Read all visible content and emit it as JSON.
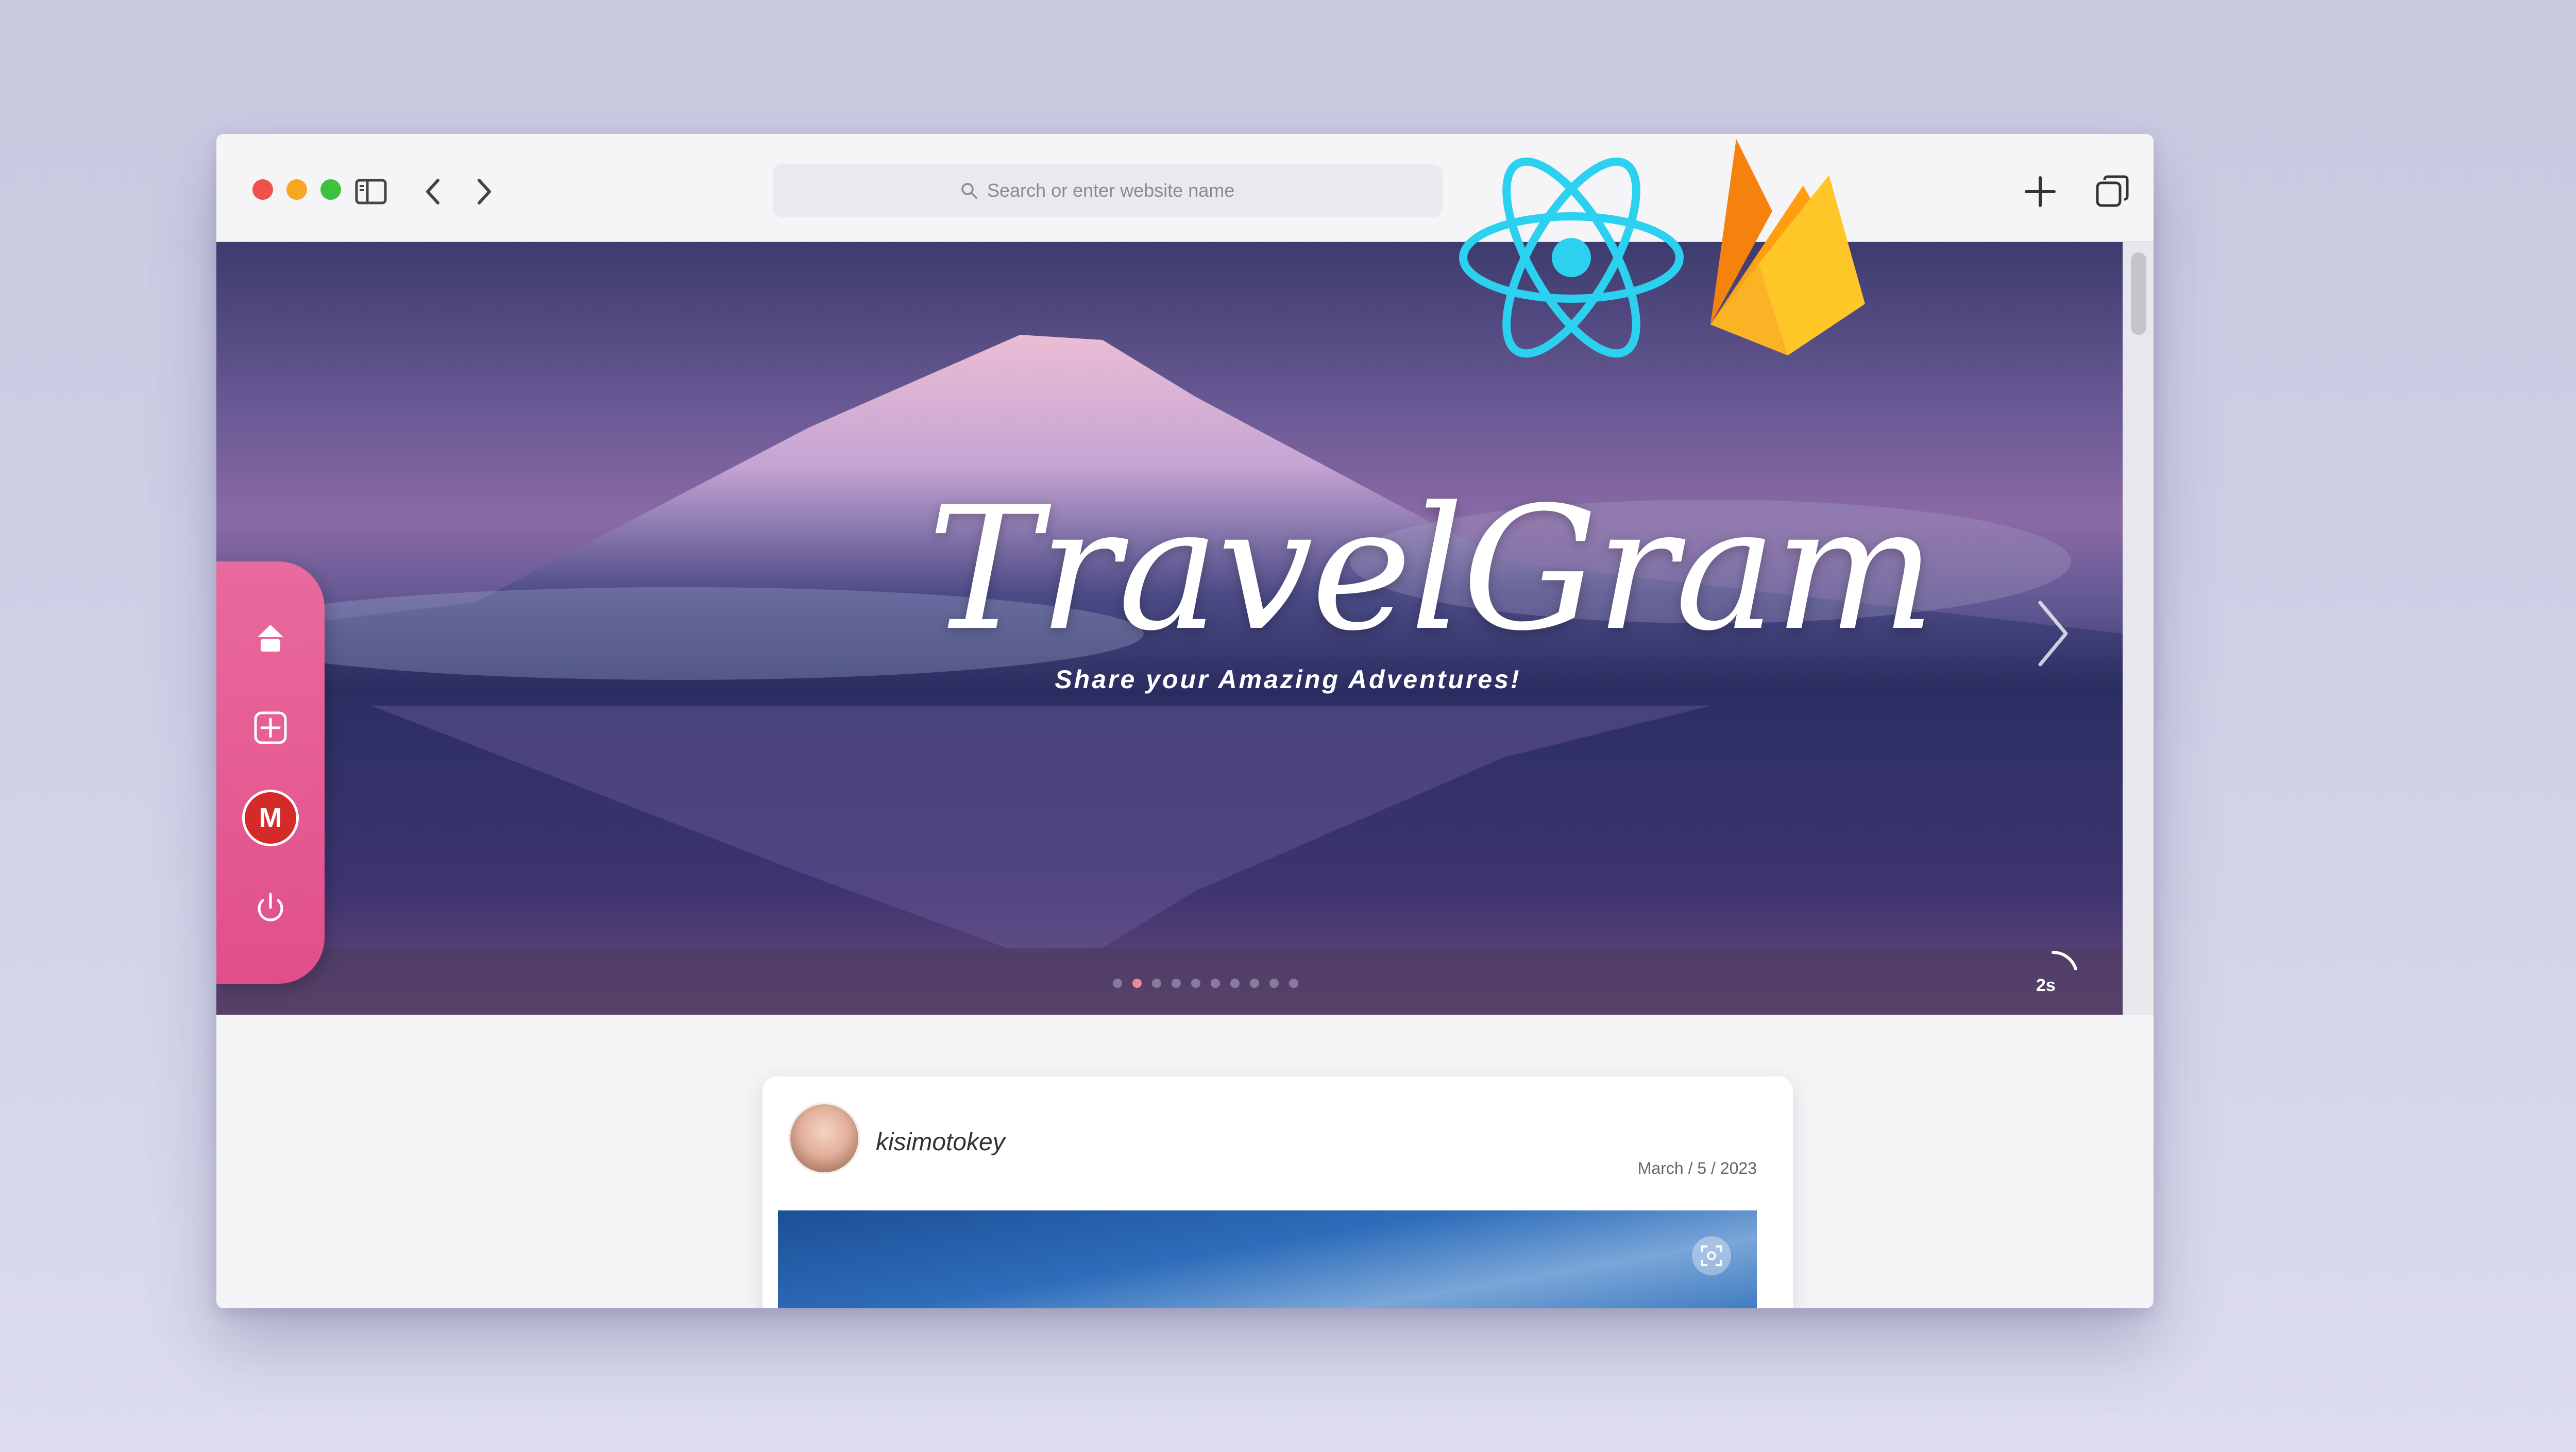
{
  "browser": {
    "address_bar": {
      "placeholder": "Search or enter website name",
      "value": ""
    }
  },
  "hero": {
    "title": "TravelGram",
    "subtitle": "Share your Amazing Adventures!",
    "timer_label": "2s",
    "timer_fraction": 0.2,
    "dot_count": 10,
    "active_dot": 1
  },
  "post": {
    "username": "kisimotokey",
    "date": "March / 5 / 2023"
  },
  "colors": {
    "accent_pink": "#e14f8a",
    "react_blue": "#2bd1ee",
    "firebase_orange": "#f5820d",
    "firebase_yellow": "#ffc627"
  },
  "icons": {
    "toolbar": [
      "sidebar-icon",
      "back-icon",
      "forward-icon",
      "new-tab-icon",
      "tabs-icon"
    ],
    "sidenav": [
      "home-icon",
      "add-post-icon",
      "user-avatar",
      "logout-icon"
    ]
  }
}
